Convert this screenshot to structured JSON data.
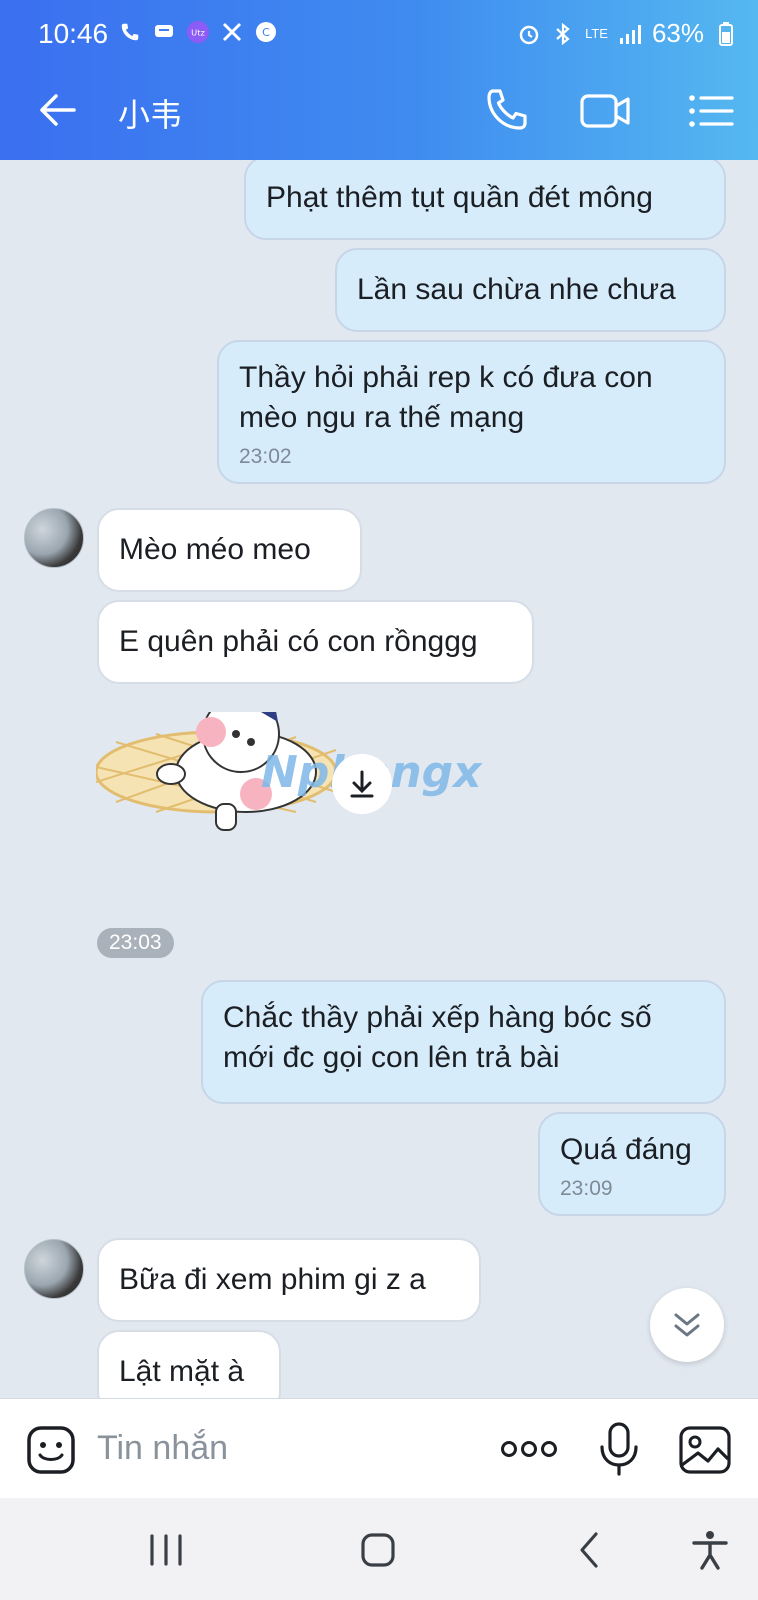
{
  "status_bar": {
    "time": "10:46",
    "lte": "LTE",
    "battery": "63%"
  },
  "header": {
    "contact_name": "小韦"
  },
  "messages": [
    {
      "dir": "out",
      "text": "Phạt thêm tụt quần đét mông"
    },
    {
      "dir": "out",
      "text": "Lần sau chừa nhe chưa"
    },
    {
      "dir": "out",
      "text": "Thầy hỏi phải rep k có đưa con mèo ngu ra thế mạng",
      "time": "23:02"
    },
    {
      "dir": "in",
      "text": "Mèo méo meo"
    },
    {
      "dir": "in",
      "text": "E quên phải có con rồnggg"
    },
    {
      "dir": "in",
      "type": "sticker",
      "watermark": "Nphangx"
    },
    {
      "dir": "in",
      "type": "time",
      "time": "23:03"
    },
    {
      "dir": "out",
      "text": "Chắc thầy phải xếp hàng bóc số mới đc gọi con lên trả bài"
    },
    {
      "dir": "out",
      "text": "Quá đáng",
      "time": "23:09"
    },
    {
      "dir": "in",
      "text": "Bữa đi xem phim gi z a"
    },
    {
      "dir": "in",
      "text": "Lật mặt à"
    }
  ],
  "composer": {
    "placeholder": "Tin nhắn"
  },
  "icons": [
    "back-arrow-icon",
    "phone-icon",
    "video-camera-icon",
    "menu-list-icon",
    "sticker-smile-icon",
    "more-dots-icon",
    "microphone-icon",
    "gallery-icon",
    "download-icon",
    "chevron-double-down-icon"
  ]
}
